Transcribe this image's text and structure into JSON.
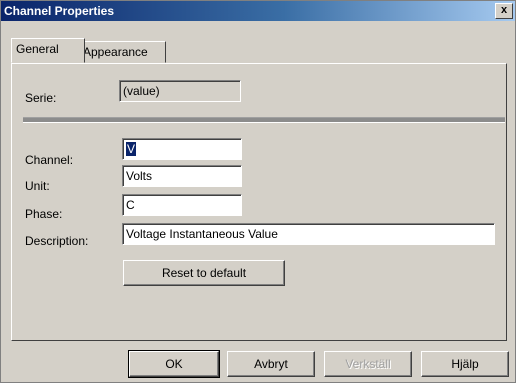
{
  "window": {
    "title": "Channel Properties",
    "close_label": "x"
  },
  "tabs": [
    {
      "label": "General",
      "active": true
    },
    {
      "label": "Appearance",
      "active": false
    }
  ],
  "fields": {
    "serie": {
      "label": "Serie:",
      "value": "(value)"
    },
    "channel": {
      "label": "Channel:",
      "value": "V"
    },
    "unit": {
      "label": "Unit:",
      "value": "Volts"
    },
    "phase": {
      "label": "Phase:",
      "value": "C"
    },
    "description": {
      "label": "Description:",
      "value": "Voltage Instantaneous Value"
    }
  },
  "reset_button": {
    "label": "Reset to default"
  },
  "footer_buttons": {
    "ok": "OK",
    "cancel": "Avbryt",
    "apply": "Verkställ",
    "help": "Hjälp"
  }
}
